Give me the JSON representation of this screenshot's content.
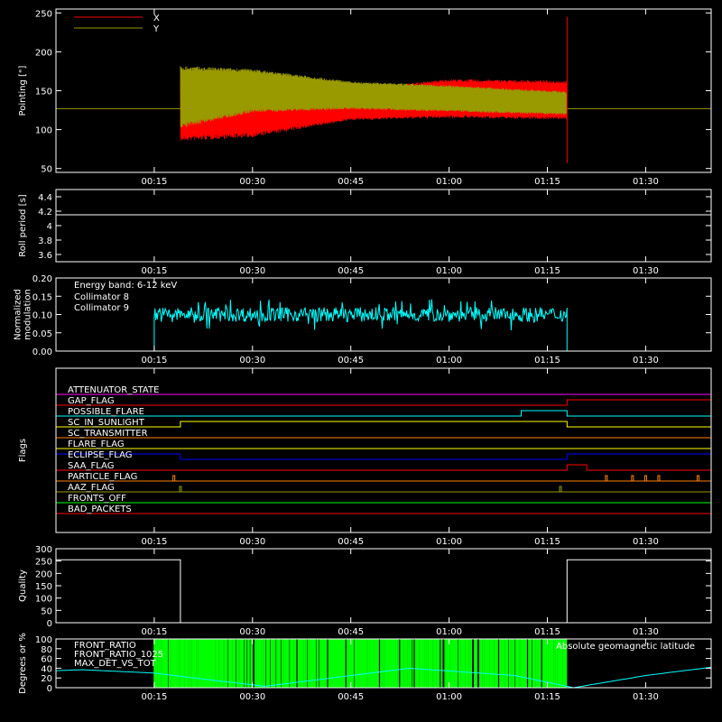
{
  "chart_data": [
    {
      "type": "line",
      "ylabel": "Pointing [\"]",
      "ylim": [
        45,
        255
      ],
      "yticks": [
        50,
        100,
        150,
        200,
        250
      ],
      "legend": [
        {
          "name": "X",
          "color": "#ff0000"
        },
        {
          "name": "Y",
          "color": "#999900"
        }
      ],
      "series": [
        {
          "name": "X",
          "color": "#ff0000",
          "start_time": "00:19",
          "end_time": "01:18",
          "center_times": [
            "00:19",
            "00:30",
            "00:45",
            "01:00",
            "01:18"
          ],
          "centers": [
            130,
            130,
            132,
            140,
            138
          ],
          "amplitudes": [
            45,
            40,
            20,
            25,
            25
          ]
        },
        {
          "name": "Y",
          "color": "#999900",
          "start_time": "00:19",
          "end_time": "01:18",
          "center_times": [
            "00:19",
            "00:30",
            "00:45",
            "01:00",
            "01:18"
          ],
          "centers": [
            142,
            150,
            144,
            140,
            134
          ],
          "amplitudes": [
            40,
            28,
            18,
            17,
            15
          ]
        }
      ],
      "reference_line": {
        "value": 127,
        "color": "#999900"
      },
      "spike": {
        "time": "01:18",
        "min": 57,
        "max": 245
      }
    },
    {
      "type": "line",
      "ylabel": "Roll period [s]",
      "ylim": [
        3.5,
        4.5
      ],
      "yticks": [
        3.6,
        3.8,
        4.0,
        4.2,
        4.4
      ],
      "series": [
        {
          "name": "",
          "color": "#ffffff",
          "value": 4.15
        }
      ]
    },
    {
      "type": "line",
      "ylabel": "Normalized modulation",
      "ylim": [
        0,
        0.2
      ],
      "yticks": [
        "0.00",
        "0.05",
        "0.10",
        "0.15",
        "0.20"
      ],
      "annotation": "Energy band: 6-12 keV",
      "legend": [
        {
          "name": "Collimator 8",
          "color": "#00ffff"
        },
        {
          "name": "Collimator 9",
          "color": "#ff00ff"
        }
      ],
      "series": [
        {
          "name": "Collimator 8",
          "color": "#00ffff",
          "start_time": "00:15",
          "end_time": "01:18",
          "mean": 0.1,
          "spread": 0.02
        },
        {
          "name": "Collimator 9",
          "color": "#ff00ff",
          "value": 0.0
        }
      ]
    },
    {
      "type": "line",
      "ylabel": "Flags",
      "flags": [
        {
          "name": "ATTENUATOR_STATE",
          "color": "#ff00ff",
          "segments": [
            [
              "00:00",
              "01:40",
              0
            ]
          ]
        },
        {
          "name": "GAP_FLAG",
          "color": "#ff0000",
          "segments": [
            [
              "00:00",
              "01:18",
              0
            ],
            [
              "01:18",
              "01:40",
              1
            ]
          ]
        },
        {
          "name": "POSSIBLE_FLARE",
          "color": "#00ffff",
          "segments": [
            [
              "00:00",
              "01:11",
              0
            ],
            [
              "01:11",
              "01:18",
              1
            ],
            [
              "01:18",
              "01:40",
              0
            ]
          ]
        },
        {
          "name": "SC_IN_SUNLIGHT",
          "color": "#ffff00",
          "segments": [
            [
              "00:00",
              "00:19",
              0
            ],
            [
              "00:19",
              "01:18",
              1
            ],
            [
              "01:18",
              "01:40",
              0
            ]
          ]
        },
        {
          "name": "SC_TRANSMITTER",
          "color": "#ff8000",
          "segments": [
            [
              "00:00",
              "01:40",
              0
            ]
          ]
        },
        {
          "name": "FLARE_FLAG",
          "color": "#ffff00",
          "segments": [
            [
              "00:00",
              "01:40",
              0
            ]
          ]
        },
        {
          "name": "ECLIPSE_FLAG",
          "color": "#0000ff",
          "segments": [
            [
              "00:00",
              "00:19",
              1
            ],
            [
              "00:19",
              "01:18",
              0
            ],
            [
              "01:18",
              "01:40",
              1
            ]
          ]
        },
        {
          "name": "SAA_FLAG",
          "color": "#ff0000",
          "segments": [
            [
              "00:00",
              "01:18",
              0
            ],
            [
              "01:18",
              "01:21",
              1
            ],
            [
              "01:21",
              "01:40",
              0
            ]
          ]
        },
        {
          "name": "PARTICLE_FLAG",
          "color": "#ff8000",
          "segments": [
            [
              "00:00",
              "01:40",
              0
            ]
          ],
          "pulses": [
            "00:18",
            "01:24",
            "01:28",
            "01:30",
            "01:32",
            "01:38"
          ]
        },
        {
          "name": "AAZ_FLAG",
          "color": "#999900",
          "segments": [
            [
              "00:00",
              "01:40",
              0
            ]
          ],
          "pulses": [
            "00:19",
            "01:17"
          ]
        },
        {
          "name": "FRONTS_OFF",
          "color": "#00ff00",
          "segments": [
            [
              "00:00",
              "01:40",
              0
            ]
          ]
        },
        {
          "name": "BAD_PACKETS",
          "color": "#ff0000",
          "segments": [
            [
              "00:00",
              "01:40",
              0
            ]
          ]
        }
      ]
    },
    {
      "type": "line",
      "ylabel": "Quality",
      "ylim": [
        0,
        300
      ],
      "yticks": [
        0,
        50,
        100,
        150,
        200,
        250,
        300
      ],
      "series": [
        {
          "name": "",
          "color": "#ffffff",
          "points": [
            [
              "00:00",
              255
            ],
            [
              "00:19",
              255
            ],
            [
              "00:19",
              0
            ],
            [
              "01:18",
              0
            ],
            [
              "01:18",
              255
            ],
            [
              "01:40",
              255
            ]
          ]
        }
      ]
    },
    {
      "type": "line",
      "ylabel": "Degrees or %",
      "ylim": [
        0,
        100
      ],
      "yticks": [
        0,
        20,
        40,
        60,
        80,
        100
      ],
      "legend": [
        {
          "name": "FRONT_RATIO",
          "color": "#ffff00"
        },
        {
          "name": "FRONT_RATIO_1025",
          "color": "#00ff00"
        },
        {
          "name": "MAX_DET_VS_TOT",
          "color": "#ff8000"
        }
      ],
      "annotation": "Absolute geomagnetic latitude",
      "annotation_color": "#00ffff",
      "front_ratio_band": {
        "start_time": "00:15",
        "end_time": "01:18",
        "color": "#00ff00",
        "value": 100
      },
      "latitude": {
        "color": "#00ffff",
        "times": [
          "00:00",
          "00:04",
          "00:15",
          "00:26",
          "00:32",
          "00:45",
          "00:54",
          "01:10",
          "01:19",
          "01:30",
          "01:40"
        ],
        "values": [
          35,
          37,
          30,
          12,
          3,
          25,
          40,
          25,
          0,
          25,
          42
        ]
      }
    }
  ],
  "x_axis": {
    "range": [
      "00:00",
      "01:40"
    ],
    "ticks": [
      "00:15",
      "00:30",
      "00:45",
      "01:00",
      "01:15",
      "01:30"
    ]
  }
}
